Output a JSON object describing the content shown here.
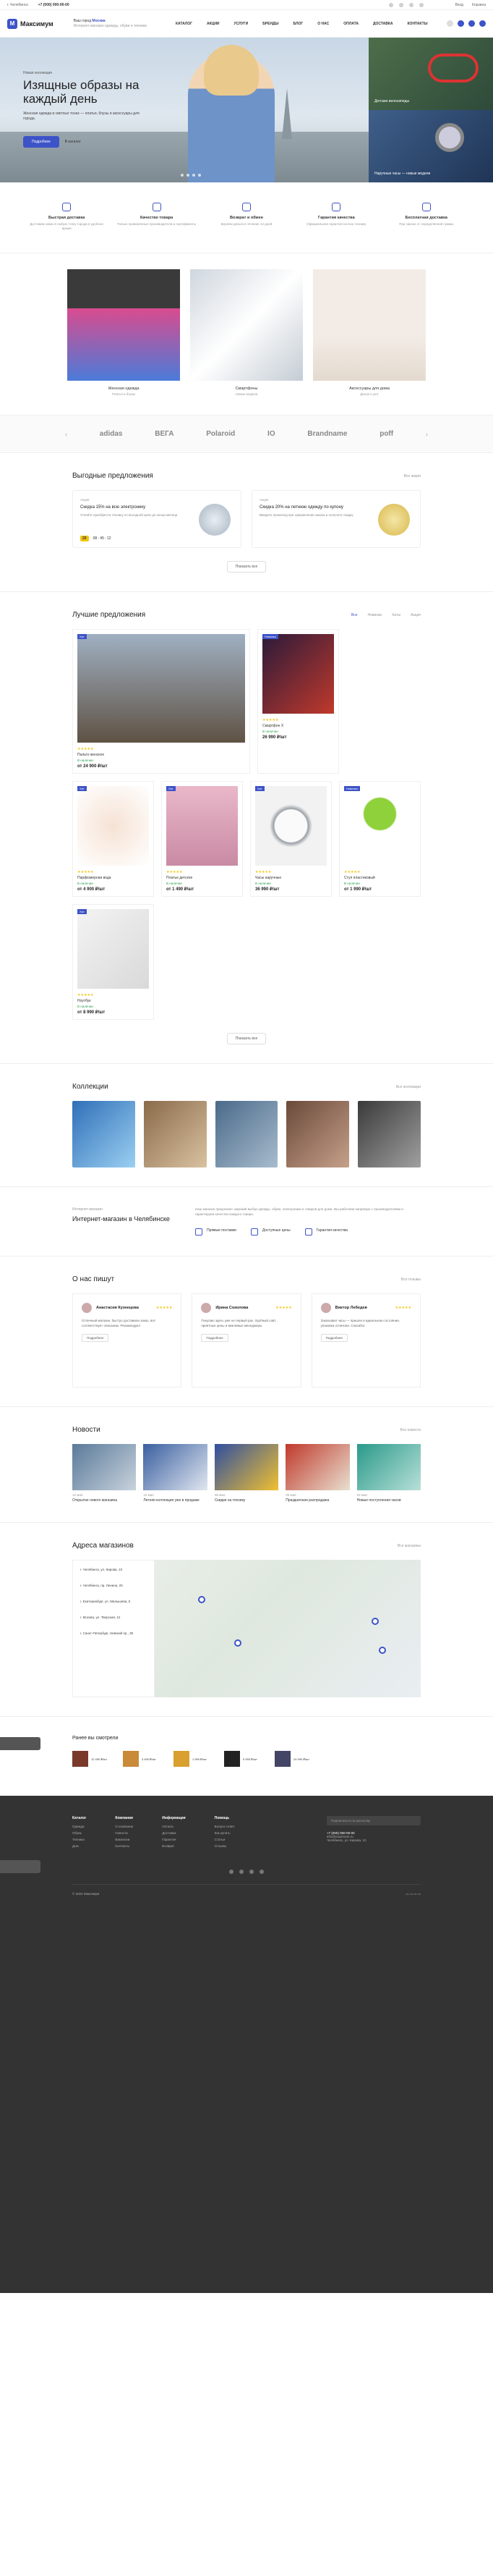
{
  "topbar": {
    "phone": "+7 (000) 000-00-00",
    "address": "г. Челябинск",
    "right_links": [
      "Вход",
      "Корзина"
    ]
  },
  "header": {
    "logo_text": "Максимум",
    "region_label": "Ваш город",
    "region_city": "Москва",
    "region_note": "Интернет-магазин одежды, обуви и техники",
    "nav": [
      "Каталог",
      "Акции",
      "Услуги",
      "Бренды",
      "Блог",
      "О нас",
      "Оплата",
      "Доставка",
      "Контакты"
    ]
  },
  "hero": {
    "caption": "Новая коллекция",
    "title": "Изящные образы на каждый день",
    "text": "Женская одежда в светлых тонах — платья, блузы и аксессуары для города.",
    "btn_primary": "Подробнее",
    "btn_secondary": "В каталог",
    "side": [
      {
        "label": "Детские велосипеды"
      },
      {
        "label": "Наручные часы — новые модели"
      }
    ]
  },
  "features": [
    {
      "title": "Быстрая доставка",
      "desc": "Доставим заказ в любую точку города в удобное время"
    },
    {
      "title": "Качество товара",
      "desc": "Только проверенные производители и сертификаты"
    },
    {
      "title": "Возврат и обмен",
      "desc": "Вернём деньги в течение 14 дней"
    },
    {
      "title": "Гарантия качества",
      "desc": "Официальная гарантия на всю технику"
    },
    {
      "title": "Бесплатная доставка",
      "desc": "При заказе от определённой суммы"
    }
  ],
  "categories": [
    {
      "title": "Женская одежда",
      "desc": "Платья и блузы"
    },
    {
      "title": "Смартфоны",
      "desc": "Новые модели"
    },
    {
      "title": "Аксессуары для дома",
      "desc": "Декор и уют"
    }
  ],
  "brands": [
    "adidas",
    "ВЕГА",
    "Polaroid",
    "IO",
    "Brandname",
    "poff"
  ],
  "offers": {
    "title": "Выгодные предложения",
    "link": "Все акции",
    "items": [
      {
        "cap": "Акция",
        "title": "Скидка 15% на всю электронику",
        "desc": "Успейте приобрести технику по выгодной цене до конца месяца",
        "badge": "20",
        "time": "08 : 45 : 12"
      },
      {
        "cap": "Акция",
        "title": "Скидка 20% на летнюю одежду по купону",
        "desc": "Введите промокод при оформлении заказа и получите скидку"
      }
    ],
    "more": "Показать все"
  },
  "products": {
    "title": "Лучшие предложения",
    "tabs": [
      "Все",
      "Новинки",
      "Хиты",
      "Акция"
    ],
    "items": [
      {
        "tag": "Хит",
        "name": "Пальто женское",
        "price": "от 24 900 ₽/шт",
        "avail": "В наличии"
      },
      {
        "tag": "Новинка",
        "name": "Смартфон X",
        "price": "26 990 ₽/шт",
        "avail": "В наличии"
      },
      {
        "tag": "Хит",
        "name": "Парфюмерная вода",
        "price": "от 4 900 ₽/шт",
        "avail": "В наличии"
      },
      {
        "tag": "Хит",
        "name": "Платье детское",
        "price": "от 1 490 ₽/шт",
        "avail": "В наличии"
      },
      {
        "tag": "Хит",
        "name": "Часы наручные",
        "price": "36 990 ₽/шт",
        "avail": "В наличии"
      },
      {
        "tag": "Новинка",
        "name": "Стул пластиковый",
        "price": "от 1 990 ₽/шт",
        "avail": "В наличии"
      },
      {
        "tag": "Хит",
        "name": "Ноутбук",
        "price": "от 8 990 ₽/шт",
        "avail": "В наличии"
      }
    ],
    "more": "Показать все"
  },
  "collections": {
    "title": "Коллекции",
    "link": "Все коллекции"
  },
  "about": {
    "caption": "Интернет-магазин",
    "title": "Интернет-магазин в Челябинске",
    "text": "Наш магазин предлагает широкий выбор одежды, обуви, электроники и товаров для дома. Мы работаем напрямую с производителями и гарантируем качество каждого товара.",
    "feats": [
      "Прямые поставки",
      "Доступные цены",
      "Гарантия качества"
    ]
  },
  "reviews": {
    "title": "О нас пишут",
    "link": "Все отзывы",
    "items": [
      {
        "name": "Анастасия Кузнецова",
        "text": "Отличный магазин, быстро доставили заказ, всё соответствует описанию. Рекомендую!",
        "btn": "Подробнее"
      },
      {
        "name": "Ирина Соколова",
        "text": "Покупаю здесь уже не первый раз. Удобный сайт, приятные цены и вежливые менеджеры.",
        "btn": "Подробнее"
      },
      {
        "name": "Виктор Лебедев",
        "text": "Заказывал часы — пришли в идеальном состоянии, упаковка отличная. Спасибо!",
        "btn": "Подробнее"
      }
    ]
  },
  "news": {
    "title": "Новости",
    "link": "Все новости",
    "items": [
      {
        "date": "12 мая",
        "title": "Открытие нового магазина"
      },
      {
        "date": "10 мая",
        "title": "Летняя коллекция уже в продаже"
      },
      {
        "date": "08 мая",
        "title": "Скидки на технику"
      },
      {
        "date": "05 мая",
        "title": "Праздничная распродажа"
      },
      {
        "date": "02 мая",
        "title": "Новые поступления часов"
      }
    ]
  },
  "stores": {
    "title": "Адреса магазинов",
    "link": "Все магазины",
    "items": [
      "г. Челябинск, ул. Кирова, 10",
      "г. Челябинск, пр. Ленина, 25",
      "г. Екатеринбург, ул. Малышева, 5",
      "г. Москва, ул. Тверская, 12",
      "г. Санкт-Петербург, Невский пр., 30"
    ]
  },
  "viewed": {
    "title": "Ранее вы смотрели",
    "items": [
      "12 490 ₽/шт",
      "3 490 ₽/шт",
      "1 990 ₽/шт",
      "5 990 ₽/шт",
      "24 990 ₽/шт"
    ]
  },
  "footer": {
    "cols": [
      {
        "h": "Каталог",
        "items": [
          "Одежда",
          "Обувь",
          "Техника",
          "Дом"
        ]
      },
      {
        "h": "Компания",
        "items": [
          "О компании",
          "Новости",
          "Вакансии",
          "Контакты"
        ]
      },
      {
        "h": "Информация",
        "items": [
          "Оплата",
          "Доставка",
          "Гарантия",
          "Возврат"
        ]
      },
      {
        "h": "Помощь",
        "items": [
          "Вопрос-ответ",
          "Как купить",
          "Статьи",
          "Отзывы"
        ]
      }
    ],
    "subscribe_placeholder": "Подписаться на рассылку",
    "phone": "+7 (000) 000-00-00",
    "email": "info@maximum.ru",
    "address": "Челябинск, ул. Кирова, 10",
    "copyright": "© 2024 Максимум"
  }
}
